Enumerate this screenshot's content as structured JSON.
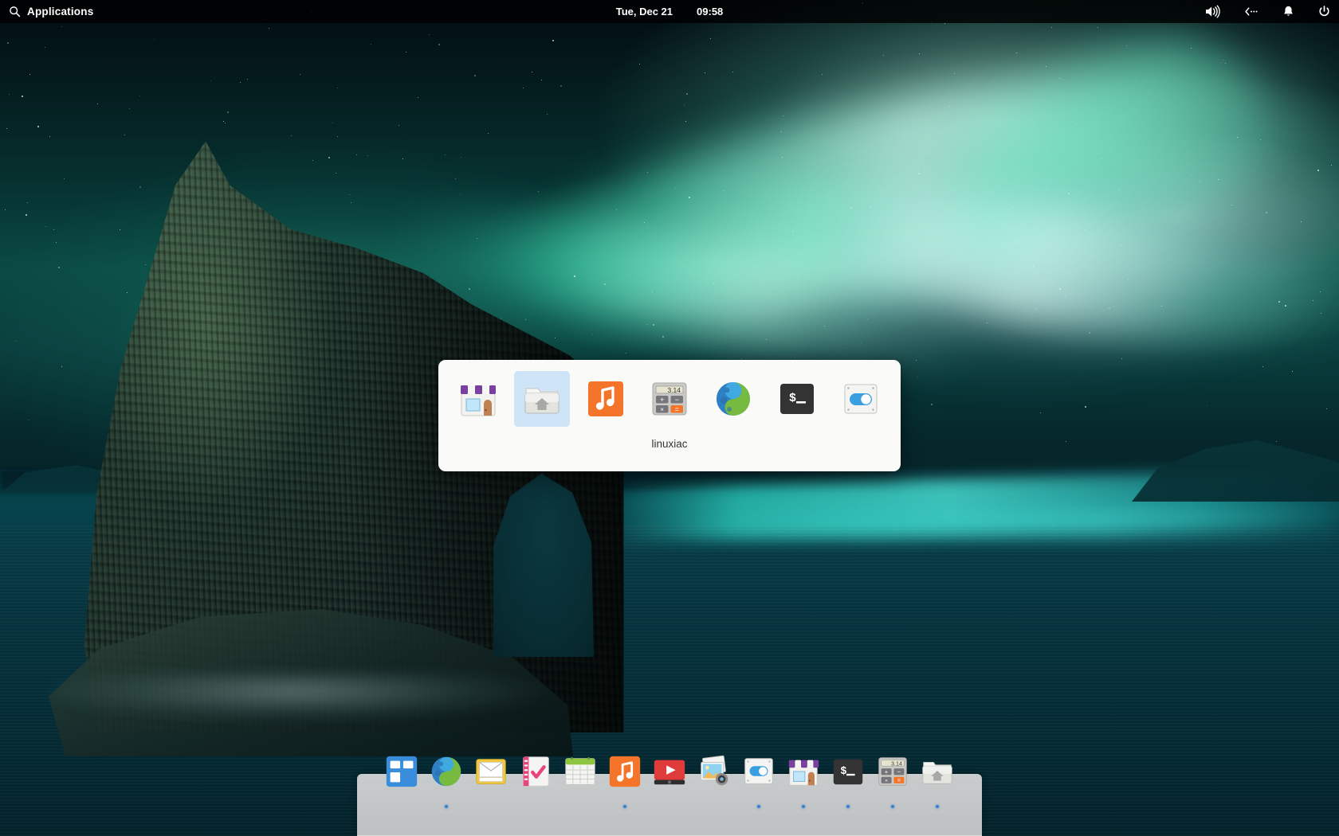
{
  "panel": {
    "applications_label": "Applications",
    "search_icon": "search-icon",
    "date": "Tue, Dec 21",
    "time": "09:58",
    "indicators": [
      {
        "name": "sound-icon",
        "label": "Sound"
      },
      {
        "name": "network-icon",
        "label": "Network"
      },
      {
        "name": "notifications-icon",
        "label": "Notifications"
      },
      {
        "name": "power-icon",
        "label": "Session"
      }
    ]
  },
  "switcher": {
    "selected_label": "linuxiac",
    "selected_index": 1,
    "items": [
      {
        "name": "appcenter-icon",
        "label": "AppCenter"
      },
      {
        "name": "files-icon",
        "label": "Files"
      },
      {
        "name": "music-icon",
        "label": "Music"
      },
      {
        "name": "calculator-icon",
        "label": "Calculator",
        "display": "3.14"
      },
      {
        "name": "web-browser-icon",
        "label": "Web"
      },
      {
        "name": "terminal-icon",
        "label": "Terminal",
        "display": "$_"
      },
      {
        "name": "system-settings-icon",
        "label": "System Settings"
      }
    ]
  },
  "dock": {
    "items": [
      {
        "name": "applications-menu-icon",
        "label": "Applications",
        "running": false
      },
      {
        "name": "web-browser-icon",
        "label": "Web",
        "running": true
      },
      {
        "name": "mail-icon",
        "label": "Mail",
        "running": false
      },
      {
        "name": "tasks-icon",
        "label": "Tasks",
        "running": false
      },
      {
        "name": "calendar-icon",
        "label": "Calendar",
        "running": false
      },
      {
        "name": "music-icon",
        "label": "Music",
        "running": true
      },
      {
        "name": "videos-icon",
        "label": "Videos",
        "running": false
      },
      {
        "name": "photos-icon",
        "label": "Photos",
        "running": false
      },
      {
        "name": "system-settings-icon",
        "label": "System Settings",
        "running": true
      },
      {
        "name": "appcenter-icon",
        "label": "AppCenter",
        "running": true
      },
      {
        "name": "terminal-icon",
        "label": "Terminal",
        "running": true,
        "display": "$_"
      },
      {
        "name": "calculator-icon",
        "label": "Calculator",
        "running": true,
        "display": "3.14"
      },
      {
        "name": "files-icon",
        "label": "Files",
        "running": true
      }
    ]
  },
  "colors": {
    "panel_bg": "#000000",
    "accent": "#3a7fd5",
    "switcher_bg": "#fafaf8",
    "switcher_selection": "#cfe4f7",
    "dock_bg": "#d6d6d6",
    "aurora_green": "#3ce8b4",
    "sea_teal": "#06434c"
  }
}
